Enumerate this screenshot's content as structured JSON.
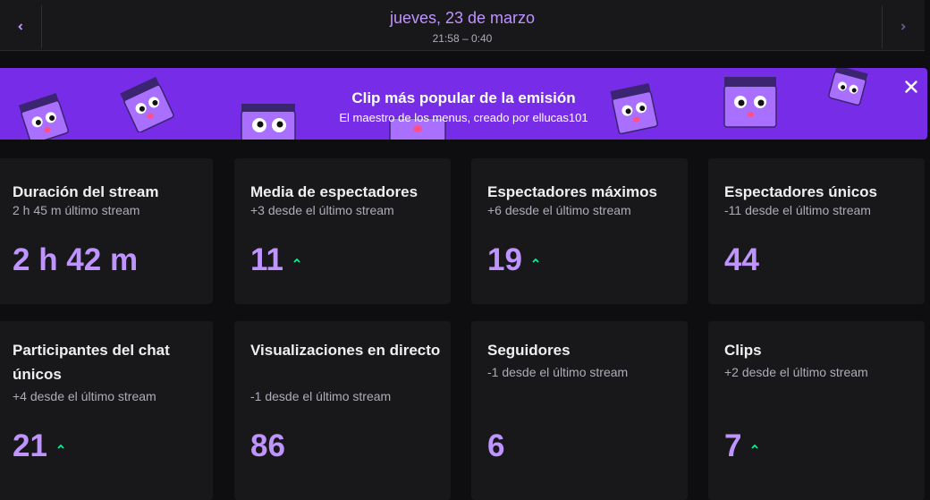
{
  "header": {
    "date": "jueves, 23 de marzo",
    "time_range": "21:58 – 0:40",
    "prev_icon": "chevron-left-icon",
    "next_icon": "chevron-right-icon"
  },
  "banner": {
    "title": "Clip más popular de la emisión",
    "subtitle": "El maestro de los menus, creado por ellucas101",
    "background": "#772ce8",
    "close_icon": "close-icon"
  },
  "colors": {
    "accent": "#bf94ff",
    "trend_up": "#00f593",
    "card_bg": "#18181b",
    "page_bg": "#0e0e10"
  },
  "stats": [
    {
      "title": "Duración del stream",
      "subtitle": "2 h 45 m último stream",
      "value": "2 h 42 m",
      "trend": ""
    },
    {
      "title": "Media de espectadores",
      "subtitle": "+3 desde el último stream",
      "value": "11",
      "trend": "up"
    },
    {
      "title": "Espectadores máximos",
      "subtitle": "+6 desde el último stream",
      "value": "19",
      "trend": "up"
    },
    {
      "title": "Espectadores únicos",
      "subtitle": "-11 desde el último stream",
      "value": "44",
      "trend": ""
    },
    {
      "title": "Participantes del chat únicos",
      "subtitle": "+4 desde el último stream",
      "value": "21",
      "trend": "up"
    },
    {
      "title": "Visualizaciones en directo",
      "subtitle": "-1 desde el último stream",
      "value": "86",
      "trend": ""
    },
    {
      "title": "Seguidores",
      "subtitle": "-1 desde el último stream",
      "value": "6",
      "trend": ""
    },
    {
      "title": "Clips",
      "subtitle": "+2 desde el último stream",
      "value": "7",
      "trend": "up"
    }
  ]
}
